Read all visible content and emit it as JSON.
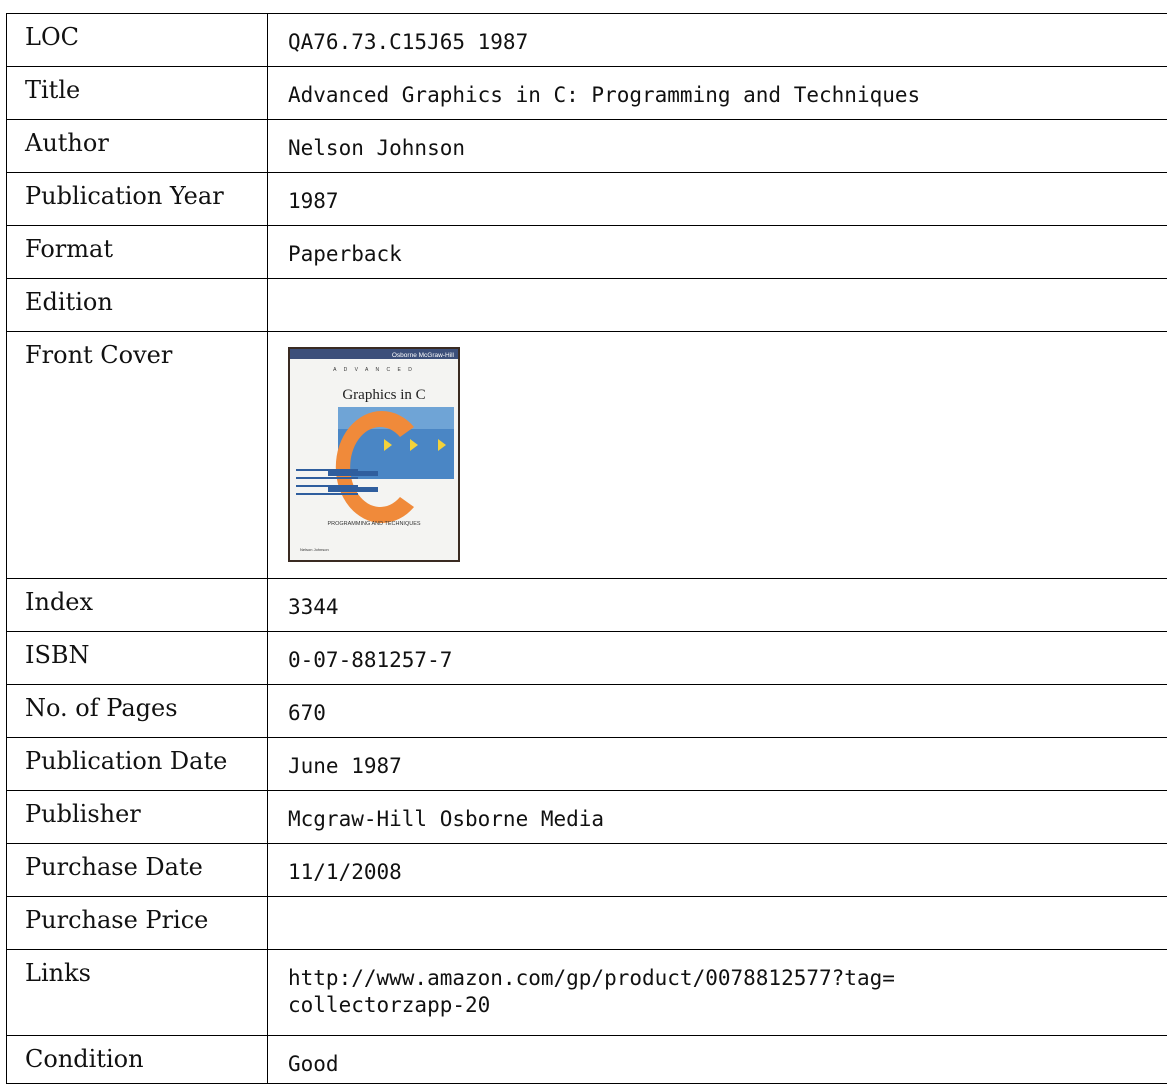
{
  "rows": [
    {
      "label": "LOC",
      "value": "QA76.73.C15J65 1987"
    },
    {
      "label": "Title",
      "value": "Advanced Graphics in C: Programming and Techniques"
    },
    {
      "label": "Author",
      "value": "Nelson Johnson"
    },
    {
      "label": "Publication Year",
      "value": "1987"
    },
    {
      "label": "Format",
      "value": "Paperback"
    },
    {
      "label": "Edition",
      "value": ""
    },
    {
      "label": "Front Cover",
      "value": ""
    },
    {
      "label": "Index",
      "value": "3344"
    },
    {
      "label": "ISBN",
      "value": "0-07-881257-7"
    },
    {
      "label": "No. of Pages",
      "value": "670"
    },
    {
      "label": "Publication Date",
      "value": "June 1987"
    },
    {
      "label": "Publisher",
      "value": "Mcgraw-Hill Osborne Media"
    },
    {
      "label": "Purchase Date",
      "value": "11/1/2008"
    },
    {
      "label": "Purchase Price",
      "value": ""
    },
    {
      "label": "Links",
      "value": "http://www.amazon.com/gp/product/0078812577?tag=",
      "value2": "collectorzapp-20"
    },
    {
      "label": "Condition",
      "value": "Good"
    }
  ],
  "cover": {
    "publisher_mark": "Osborne McGraw-Hill",
    "series": "A D V A N C E D",
    "title": "Graphics in C",
    "subtitle": "PROGRAMMING AND TECHNIQUES",
    "author": "Nelson Johnson",
    "colors": {
      "bg": "#f4f4f2",
      "band": "#4a86c5",
      "c_letter": "#f08a3a",
      "arrow": "#f3d23a",
      "bars": "#2f5e9e"
    }
  }
}
